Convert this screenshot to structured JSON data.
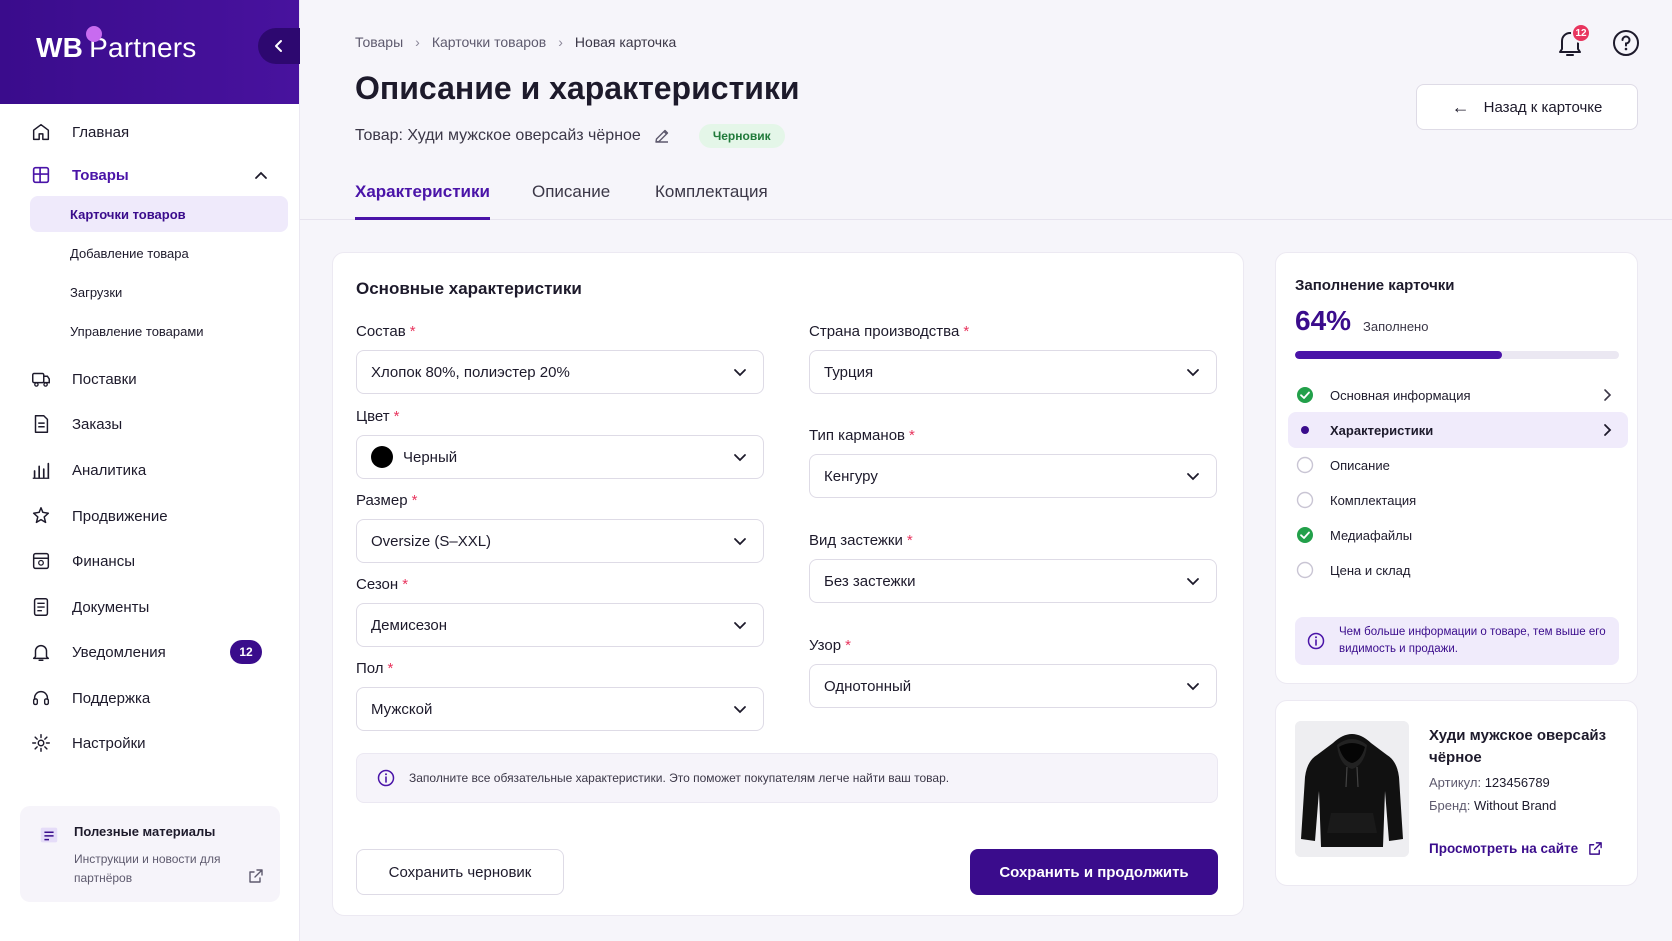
{
  "brand": {
    "logo_wb": "WB",
    "logo_partners": "Partners",
    "accent": "#3a0c8c",
    "accent_dot": "#c86bf0"
  },
  "sidebar": {
    "items": [
      {
        "label": "Главная",
        "icon": "home-icon"
      },
      {
        "label": "Товары",
        "icon": "products-icon"
      },
      {
        "label": "Поставки",
        "icon": "truck-icon"
      },
      {
        "label": "Заказы",
        "icon": "orders-icon"
      },
      {
        "label": "Аналитика",
        "icon": "chart-icon"
      },
      {
        "label": "Продвижение",
        "icon": "promo-icon"
      },
      {
        "label": "Финансы",
        "icon": "finance-icon"
      },
      {
        "label": "Документы",
        "icon": "documents-icon"
      },
      {
        "label": "Уведомления",
        "icon": "bell-icon",
        "badge": "12"
      },
      {
        "label": "Поддержка",
        "icon": "headset-icon"
      },
      {
        "label": "Настройки",
        "icon": "gear-icon"
      }
    ],
    "subitems": [
      {
        "label": "Карточки товаров"
      },
      {
        "label": "Добавление товара"
      },
      {
        "label": "Загрузки"
      },
      {
        "label": "Управление товарами"
      }
    ],
    "materials": {
      "title": "Полезные материалы",
      "desc": "Инструкции и новости для партнёров"
    }
  },
  "breadcrumb": [
    "Товары",
    "Карточки товаров",
    "Новая карточка"
  ],
  "header": {
    "title": "Описание и характеристики",
    "product_prefix": "Товар: Худи мужское оверсайз чёрное",
    "status": "Черновик",
    "back_label": "Назад к карточке",
    "notif_count": "12"
  },
  "tabs": [
    "Характеристики",
    "Описание",
    "Комплектация"
  ],
  "form": {
    "section_title": "Основные характеристики",
    "left": [
      {
        "label": "Состав",
        "value": "Хлопок 80%, полиэстер 20%"
      },
      {
        "label": "Цвет",
        "value": "Черный"
      },
      {
        "label": "Размер",
        "value": "Oversize (S–XXL)"
      },
      {
        "label": "Сезон",
        "value": "Демисезон"
      },
      {
        "label": "Пол",
        "value": "Мужской"
      }
    ],
    "right": [
      {
        "label": "Страна производства",
        "value": "Турция"
      },
      {
        "label": "Тип карманов",
        "value": "Кенгуру"
      },
      {
        "label": "Вид застежки",
        "value": "Без застежки"
      },
      {
        "label": "Узор",
        "value": "Однотонный"
      }
    ],
    "required_mark": "*",
    "info": "Заполните все обязательные характеристики. Это поможет покупателям легче найти ваш товар.",
    "save_draft": "Сохранить черновик",
    "save_continue": "Сохранить и продолжить"
  },
  "progress": {
    "title": "Заполнение карточки",
    "percent_label": "64%",
    "percent_value": 64,
    "filled_label": "Заполнено",
    "steps": [
      {
        "label": "Основная информация",
        "state": "done"
      },
      {
        "label": "Характеристики",
        "state": "current"
      },
      {
        "label": "Описание",
        "state": "todo"
      },
      {
        "label": "Комплектация",
        "state": "todo"
      },
      {
        "label": "Медиафайлы",
        "state": "done"
      },
      {
        "label": "Цена и склад",
        "state": "todo"
      }
    ],
    "tip": "Чем больше информации о товаре, тем выше его видимость и продажи."
  },
  "product": {
    "name": "Худи мужское оверсайз чёрное",
    "article_label": "Артикул:",
    "article": "123456789",
    "brand_label": "Бренд:",
    "brand": "Without Brand",
    "link": "Просмотреть на сайте"
  }
}
